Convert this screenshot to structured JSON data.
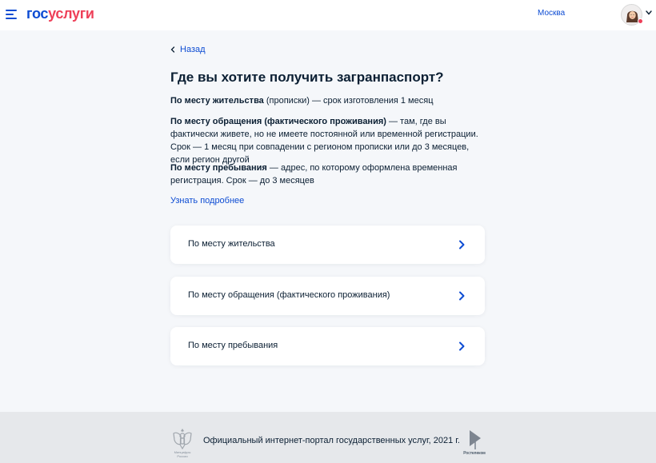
{
  "header": {
    "logo_part1": "гос",
    "logo_part2": "услуги",
    "city": "Москва",
    "menu_icon": "burger-menu-icon",
    "avatar_icon": "user-avatar-icon"
  },
  "main": {
    "back_label": "Назад",
    "title": "Где вы хотите получить загранпаспорт?",
    "paragraphs": [
      {
        "bold": "По месту жительства",
        "rest": " (прописки) — срок изготовления 1 месяц"
      },
      {
        "bold": "По месту обращения (фактического проживания)",
        "rest": " — там, где вы фактически живете, но не имеете постоянной или временной регистрации. Срок — 1 месяц при совпадении с регионом прописки или до 3 месяцев, если регион другой"
      },
      {
        "bold": "По месту пребывания",
        "rest": " — адрес, по которому оформлена временная регистрация. Срок — до 3 месяцев"
      }
    ],
    "more_link": "Узнать подробнее",
    "options": [
      {
        "label": "По месту жительства"
      },
      {
        "label": "По месту обращения (фактического проживания)"
      },
      {
        "label": "По месту пребывания"
      }
    ]
  },
  "footer": {
    "emblem_caption": "Минцифры России",
    "text": "Официальный интернет-портал государственных услуг, 2021 г.",
    "partner_caption": "Ростелеком"
  },
  "colors": {
    "brand_blue": "#0d4cd3",
    "brand_red": "#ee3f58",
    "background": "#f5f7fa",
    "footer_bg": "#e6e8eb"
  }
}
